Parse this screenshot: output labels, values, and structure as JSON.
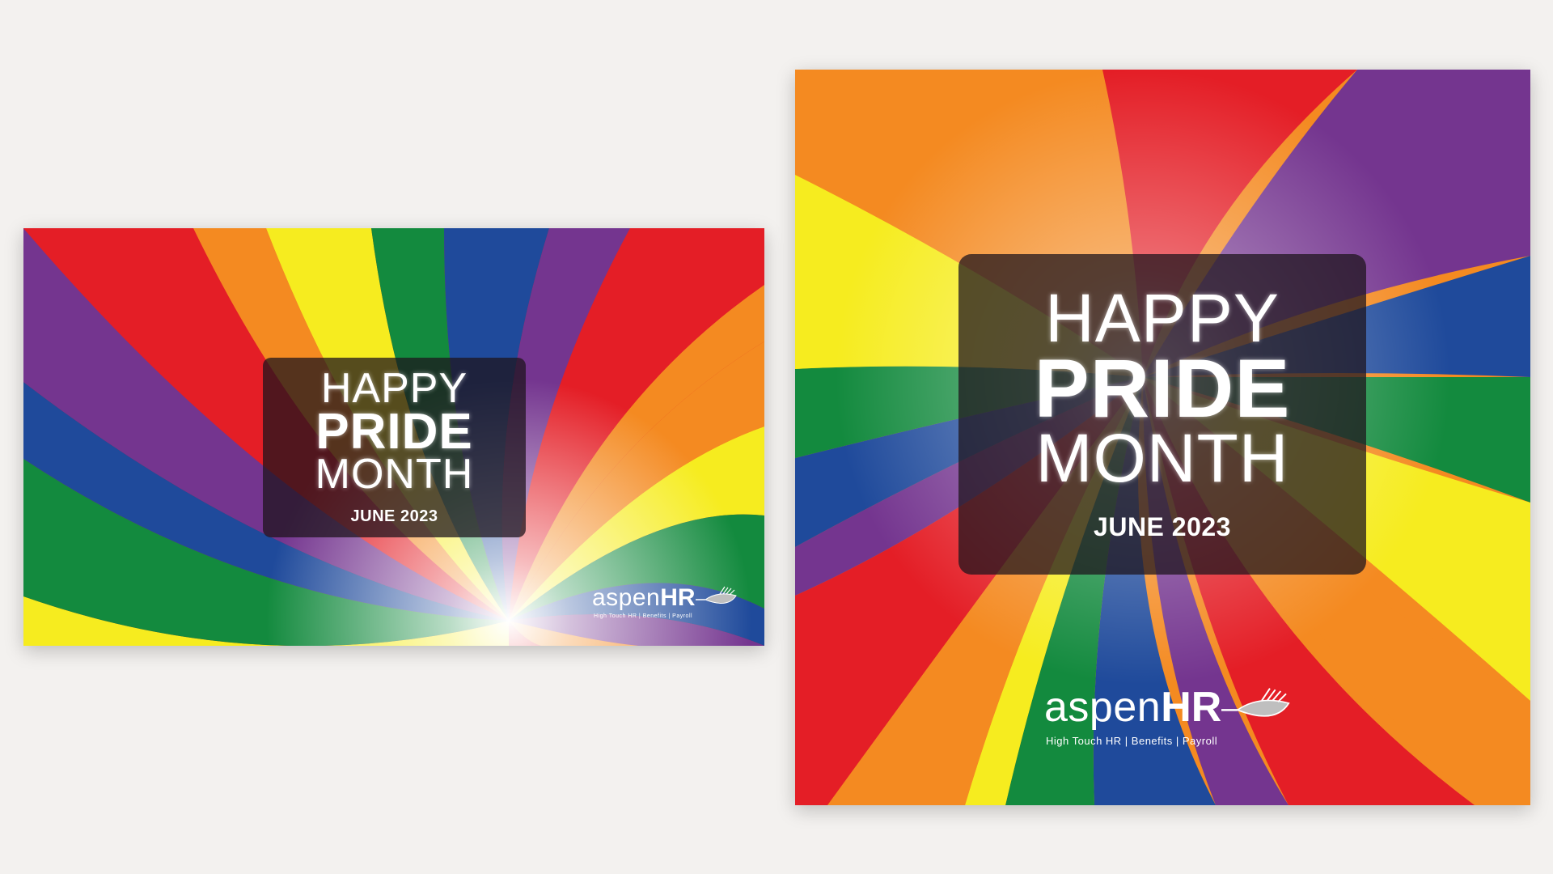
{
  "colors": {
    "red": "#e41e26",
    "orange": "#f48a21",
    "yellow": "#f6ec1f",
    "green": "#138a3e",
    "blue": "#1f4a9b",
    "purple": "#74358f",
    "overlay": "#1e141c",
    "page_bg": "#f3f1ef"
  },
  "banner_wide": {
    "headline_top": "HAPPY",
    "headline_main": "PRIDE",
    "headline_bottom": "MONTH",
    "date": "JUNE 2023",
    "logo": {
      "name_light": "aspen",
      "name_bold": "HR",
      "tagline": "High Touch HR  |  Benefits  |  Payroll",
      "icon": "leaf-icon"
    }
  },
  "banner_square": {
    "headline_top": "HAPPY",
    "headline_main": "PRIDE",
    "headline_bottom": "MONTH",
    "date": "JUNE 2023",
    "logo": {
      "name_light": "aspen",
      "name_bold": "HR",
      "tagline": "High Touch HR  |  Benefits  |  Payroll",
      "icon": "leaf-icon"
    }
  }
}
